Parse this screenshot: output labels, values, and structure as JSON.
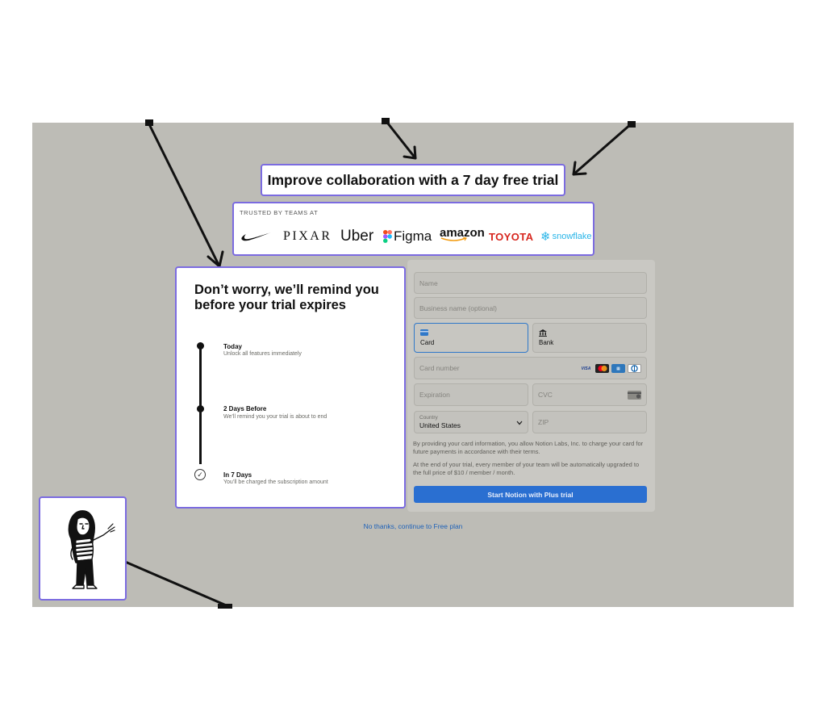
{
  "headline": "Improve collaboration with a 7 day free trial",
  "trusted_by": {
    "label": "TRUSTED BY TEAMS AT",
    "logos": [
      "nike-swoosh-icon",
      "PIXAR",
      "Uber",
      "Figma",
      "amazon",
      "TOYOTA",
      "snowflake"
    ]
  },
  "reminder": {
    "title": "Don’t worry, we’ll remind you before your trial expires",
    "steps": [
      {
        "title": "Today",
        "description": "Unlock all features immediately"
      },
      {
        "title": "2 Days Before",
        "description": "We’ll remind you your trial is about to end"
      },
      {
        "title": "In 7 Days",
        "description": "You’ll be charged the subscription amount"
      }
    ]
  },
  "form": {
    "name_placeholder": "Name",
    "business_placeholder": "Business name (optional)",
    "payment_methods": [
      {
        "label": "Card",
        "icon": "credit-card-icon",
        "selected": true
      },
      {
        "label": "Bank",
        "icon": "bank-icon",
        "selected": false
      }
    ],
    "card_number_placeholder": "Card number",
    "card_brands": [
      "VISA",
      "mastercard",
      "amex",
      "diners"
    ],
    "expiration_placeholder": "Expiration",
    "cvc_placeholder": "CVC",
    "country_label": "Country",
    "country_value": "United States",
    "zip_placeholder": "ZIP",
    "legal_1": "By providing your card information, you allow Notion Labs, Inc. to charge your card for future payments in accordance with their terms.",
    "legal_2": "At the end of your trial, every member of your team will be automatically upgraded to the full price of $10 / member / month.",
    "submit_label": "Start Notion with Plus trial",
    "decline_label": "No thanks, continue to Free plan"
  },
  "colors": {
    "highlight_border": "#7b6be0",
    "cta": "#2a6fd1",
    "toyota": "#d7261e",
    "snowflake": "#29b5e8"
  }
}
